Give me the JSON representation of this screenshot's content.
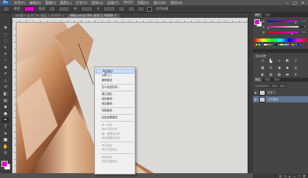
{
  "app": {
    "logo": "Ps"
  },
  "menu": [
    "文件(F)",
    "编辑(E)",
    "图像(I)",
    "图层(L)",
    "文字(Y)",
    "选择(S)",
    "滤镜(T)",
    "3D(D)",
    "视图(V)",
    "窗口(W)",
    "帮助(H)"
  ],
  "window_controls": [
    "−",
    "□",
    "×"
  ],
  "options": {
    "swatch_color": "#e000c8",
    "labels": [
      "填充:",
      "描边:",
      "W:",
      "H:",
      "对齐边缘"
    ],
    "align_edges_label": "对齐边缘"
  },
  "tabs": [
    {
      "label": "未标题-1 @ 66.7% (图层 1, RGB/8) ×",
      "active": false
    },
    {
      "label": "拼接.psd @ 50% (形状 1, RGB/8) ×",
      "active": true
    }
  ],
  "tools": [
    {
      "icon": "move-icon",
      "glyph": "✥"
    },
    {
      "icon": "marquee-icon",
      "glyph": "⬚"
    },
    {
      "icon": "lasso-icon",
      "glyph": "◌"
    },
    {
      "icon": "quick-select-icon",
      "glyph": "✎"
    },
    {
      "icon": "crop-icon",
      "glyph": "⌗"
    },
    {
      "icon": "eyedropper-icon",
      "glyph": "⁄"
    },
    {
      "icon": "healing-icon",
      "glyph": "✚"
    },
    {
      "icon": "brush-icon",
      "glyph": "✐"
    },
    {
      "icon": "stamp-icon",
      "glyph": "⊥"
    },
    {
      "icon": "history-brush-icon",
      "glyph": "↺"
    },
    {
      "icon": "eraser-icon",
      "glyph": "◧"
    },
    {
      "icon": "gradient-icon",
      "glyph": "▤"
    },
    {
      "icon": "blur-icon",
      "glyph": "◆"
    },
    {
      "icon": "dodge-icon",
      "glyph": "●"
    },
    {
      "icon": "pen-icon",
      "glyph": "✒"
    },
    {
      "icon": "type-icon",
      "glyph": "T"
    },
    {
      "icon": "path-select-icon",
      "glyph": "➤"
    },
    {
      "icon": "shape-icon",
      "glyph": "■"
    },
    {
      "icon": "hand-icon",
      "glyph": "✋"
    },
    {
      "icon": "zoom-icon",
      "glyph": "⚲"
    }
  ],
  "foreground_color": "#e000c8",
  "background_color": "#ffffff",
  "context_menu": {
    "items": [
      {
        "label": "添加锚点",
        "state": "highlighted"
      },
      {
        "label": "删除锚点",
        "state": "disabled"
      },
      {
        "label": "删除路径",
        "state": "normal"
      },
      {
        "sep": true
      },
      {
        "label": "定义自定形状...",
        "state": "normal"
      },
      {
        "sep": true
      },
      {
        "label": "建立选区...",
        "state": "normal"
      },
      {
        "label": "填充路径...",
        "state": "normal"
      },
      {
        "label": "描边路径...",
        "state": "normal"
      },
      {
        "sep": true
      },
      {
        "label": "剪贴路径...",
        "state": "normal"
      },
      {
        "sep": true
      },
      {
        "label": "自由变换路径",
        "state": "normal"
      },
      {
        "sep": true
      },
      {
        "label": "统一形状",
        "state": "disabled"
      },
      {
        "label": "减去顶层形状",
        "state": "disabled"
      },
      {
        "label": "统一重叠处形状",
        "state": "disabled"
      },
      {
        "label": "减去重叠处形状",
        "state": "disabled"
      },
      {
        "sep": true
      },
      {
        "label": "拷贝填充",
        "state": "disabled"
      },
      {
        "label": "拷贝完整描边",
        "state": "disabled"
      },
      {
        "sep": true
      },
      {
        "label": "粘贴填充",
        "state": "disabled"
      },
      {
        "label": "粘贴完整描边",
        "state": "disabled"
      }
    ]
  },
  "panels": {
    "color": {
      "tabs": [
        "颜色",
        "色板"
      ],
      "sliders": [
        {
          "label": "R",
          "value": "224",
          "fraction": 0.88,
          "gradient": "linear-gradient(90deg,#0000c8,#ff00c8)"
        },
        {
          "label": "G",
          "value": "0",
          "fraction": 0.0,
          "gradient": "linear-gradient(90deg,#e000c8,#e0ffc8)"
        },
        {
          "label": "B",
          "value": "200",
          "fraction": 0.78,
          "gradient": "linear-gradient(90deg,#e00000,#e000ff)"
        }
      ]
    },
    "swatches": {
      "colors": [
        "#ff0000",
        "#ffff00",
        "#00ff00",
        "#00ffff",
        "#0000ff",
        "#ff00ff",
        "#ffffff",
        "#e0e0e0",
        "#c0c0c0",
        "#a0a0a0",
        "#808080",
        "#606060",
        "#404040",
        "#202020",
        "#000000",
        "#ff8080",
        "#ffc080",
        "#ffff80",
        "#80ff80",
        "#80ffff",
        "#8080ff",
        "#ff80ff",
        "#c00000",
        "#c06000",
        "#c0c000",
        "#00c000",
        "#00c0c0",
        "#0000c0",
        "#c000c0"
      ]
    },
    "adjustments": {
      "title": "添加调整",
      "icons": [
        {
          "name": "brightness-icon",
          "glyph": "☼"
        },
        {
          "name": "levels-icon",
          "glyph": "▙"
        },
        {
          "name": "curves-icon",
          "glyph": "∿"
        },
        {
          "name": "exposure-icon",
          "glyph": "◩"
        },
        {
          "name": "vibrance-icon",
          "glyph": "▽"
        },
        {
          "name": "hue-sat-icon",
          "glyph": "▦"
        },
        {
          "name": "color-balance-icon",
          "glyph": "⚖"
        },
        {
          "name": "bw-icon",
          "glyph": "◑"
        },
        {
          "name": "photo-filter-icon",
          "glyph": "◉"
        },
        {
          "name": "channel-mixer-icon",
          "glyph": "◎"
        },
        {
          "name": "invert-icon",
          "glyph": "◐"
        },
        {
          "name": "posterize-icon",
          "glyph": "▥"
        },
        {
          "name": "threshold-icon",
          "glyph": "▧"
        },
        {
          "name": "gradient-map-icon",
          "glyph": "▬"
        },
        {
          "name": "selective-color-icon",
          "glyph": "✕"
        }
      ]
    },
    "layers": {
      "tabs": [
        "图层",
        "通道",
        "路径"
      ],
      "rows": [
        {
          "name": "形状 1",
          "selected": false
        },
        {
          "name": "工作路径",
          "selected": true
        }
      ],
      "bottom_icons": [
        "⛓",
        "fx",
        "◐",
        "▭",
        "❐",
        "🗑"
      ]
    }
  }
}
